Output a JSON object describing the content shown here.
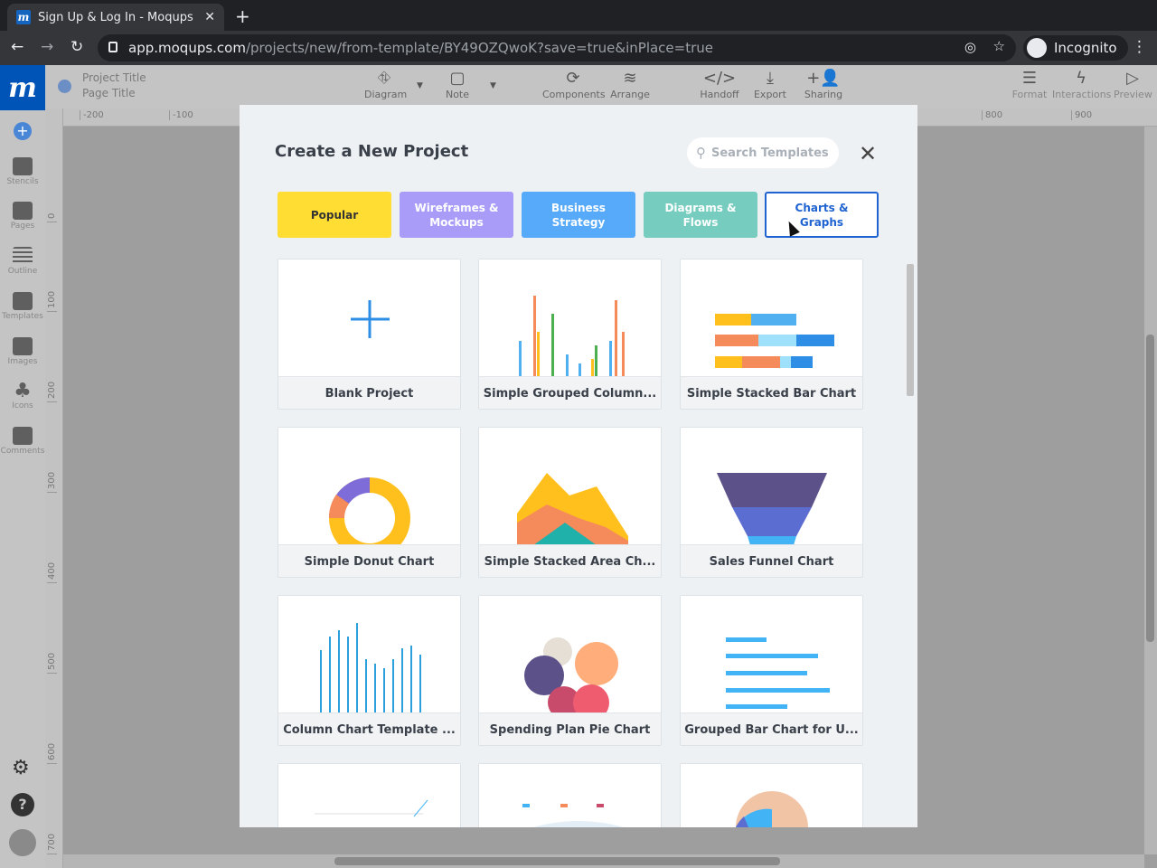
{
  "browser": {
    "tab_title": "Sign Up & Log In - Moqups",
    "url_host": "app.moqups.com",
    "url_path": "/projects/new/from-template/BY49OZQwoK?save=true&inPlace=true",
    "profile": "Incognito"
  },
  "app": {
    "logo": "m",
    "project_title": "Project Title",
    "page_title": "Page Title",
    "toolbar": [
      "Diagram",
      "Note",
      "Components",
      "Arrange",
      "Handoff",
      "Export",
      "Sharing"
    ],
    "right_tools": [
      "Format",
      "Interactions",
      "Preview"
    ],
    "sidebar": [
      "Stencils",
      "Pages",
      "Outline",
      "Templates",
      "Images",
      "Icons",
      "Comments"
    ],
    "hruler": [
      "-200",
      "-100",
      "800",
      "900"
    ],
    "vruler": [
      "0",
      "100",
      "200",
      "300",
      "400",
      "500",
      "600",
      "700"
    ]
  },
  "modal": {
    "title": "Create a New Project",
    "search_placeholder": "Search Templates",
    "categories": [
      {
        "label": "Popular",
        "color": "#ffdd33"
      },
      {
        "label": "Wireframes & Mockups",
        "color": "#a99cf9"
      },
      {
        "label": "Business Strategy",
        "color": "#56aaf9"
      },
      {
        "label": "Diagrams & Flows",
        "color": "#75ccbf"
      },
      {
        "label": "Charts & Graphs",
        "color": "#ffffff",
        "selected": true
      }
    ],
    "templates": [
      "Blank Project",
      "Simple Grouped Column...",
      "Simple Stacked Bar Chart",
      "Simple Donut Chart",
      "Simple Stacked Area Ch...",
      "Sales Funnel Chart",
      "Column Chart Template ...",
      "Spending Plan Pie Chart",
      "Grouped Bar Chart for U...",
      "",
      "",
      ""
    ]
  }
}
